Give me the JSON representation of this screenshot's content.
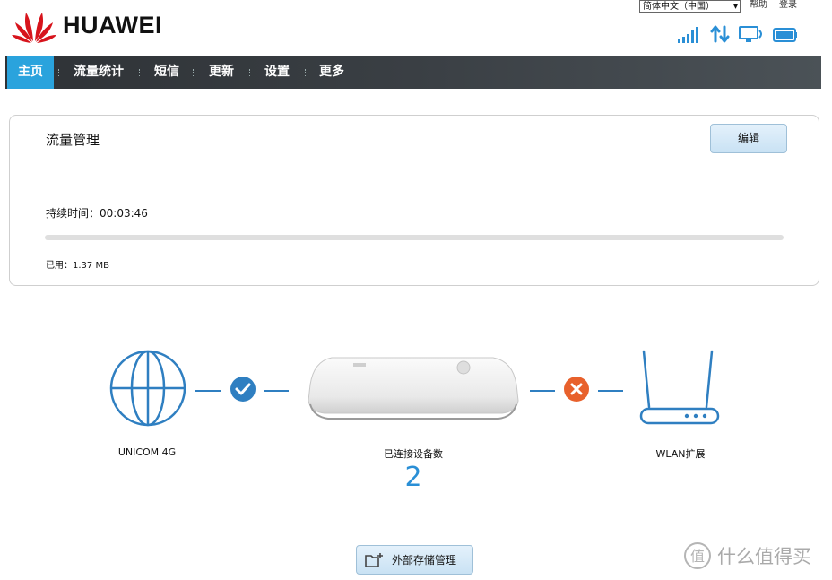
{
  "header": {
    "brand": "HUAWEI",
    "language_selected": "简体中文（中国）",
    "help_link": "帮助",
    "login_link": "登录"
  },
  "status_icons": [
    "signal-strength-icon",
    "data-transfer-icon",
    "connected-device-icon",
    "battery-icon"
  ],
  "nav": {
    "items": [
      {
        "label": "主页",
        "active": true
      },
      {
        "label": "流量统计",
        "active": false
      },
      {
        "label": "短信",
        "active": false
      },
      {
        "label": "更新",
        "active": false
      },
      {
        "label": "设置",
        "active": false
      },
      {
        "label": "更多",
        "active": false
      }
    ]
  },
  "traffic": {
    "title": "流量管理",
    "edit_label": "编辑",
    "duration": "持续时间：00:03:46",
    "used": "已用：1.37 MB",
    "progress": 0
  },
  "diagram": {
    "network_label": "UNICOM 4G",
    "network_status": "connected",
    "devices_label": "已连接设备数",
    "devices_count": "2",
    "wlan_label": "WLAN扩展",
    "wlan_status": "disconnected"
  },
  "storage": {
    "label": "外部存储管理"
  },
  "watermark": {
    "text": "什么值得买",
    "logo_char": "值"
  },
  "colors": {
    "accent": "#2aa3dd",
    "line_blue": "#2f7fc1",
    "ok": "#2f7fc1",
    "error": "#e8612c",
    "logo_red": "#d7141c"
  }
}
